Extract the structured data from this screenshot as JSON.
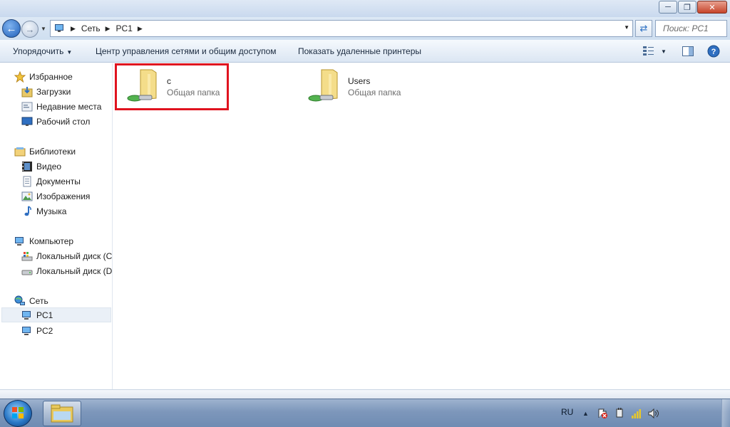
{
  "window": {
    "minimize_icon": "minimize-icon",
    "maximize_icon": "restore-icon",
    "close_icon": "close-icon"
  },
  "address": {
    "crumbs": [
      "Сеть",
      "PC1"
    ],
    "search_placeholder": "Поиск: PC1"
  },
  "toolbar": {
    "organize": "Упорядочить",
    "network_center": "Центр управления сетями и общим доступом",
    "show_printers": "Показать удаленные принтеры"
  },
  "sidebar": {
    "favorites": "Избранное",
    "downloads": "Загрузки",
    "recent": "Недавние места",
    "desktop": "Рабочий стол",
    "libraries": "Библиотеки",
    "video": "Видео",
    "documents": "Документы",
    "images": "Изображения",
    "music": "Музыка",
    "computer": "Компьютер",
    "disk_c": "Локальный диск (C",
    "disk_d": "Локальный диск (D",
    "network": "Сеть",
    "pc1": "PC1",
    "pc2": "PC2"
  },
  "content": {
    "items": [
      {
        "name": "c",
        "type": "Общая папка"
      },
      {
        "name": "Users",
        "type": "Общая папка"
      }
    ]
  },
  "taskbar": {
    "lang": "RU"
  },
  "colors": {
    "highlight": "#e0131f",
    "titlebar": "#dfe9f5",
    "taskbar": "#7d97bb"
  }
}
